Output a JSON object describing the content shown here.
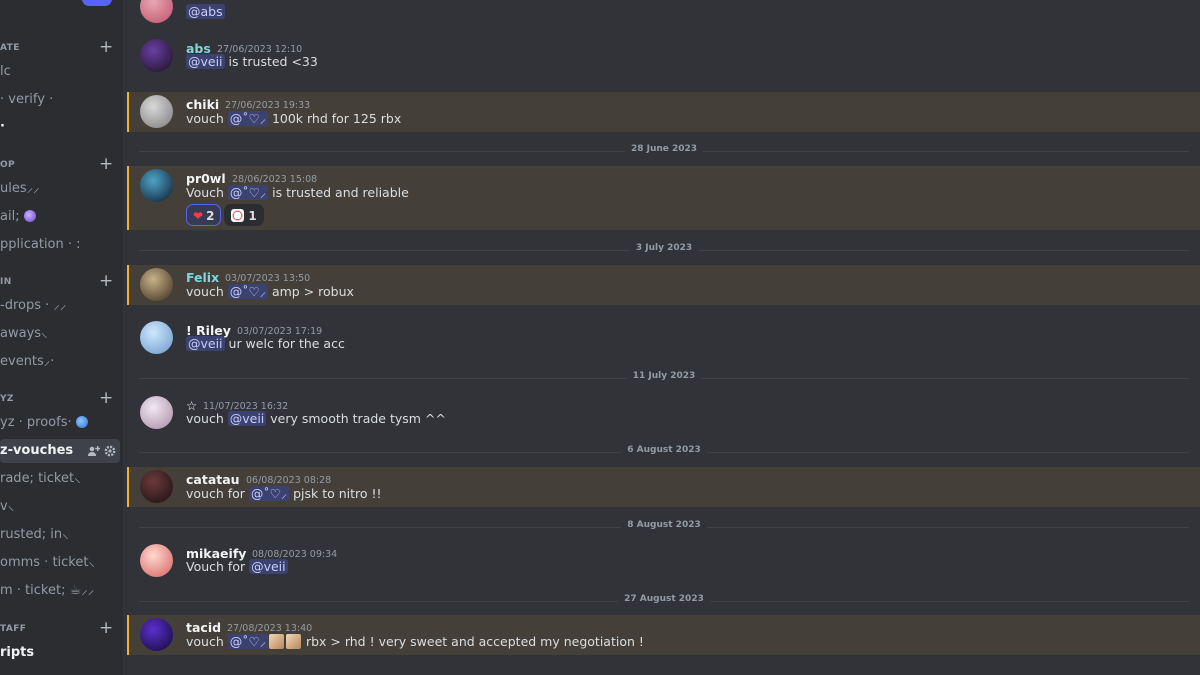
{
  "sidebar": {
    "categories": [
      {
        "label": "ATE",
        "channels": [
          {
            "label": "lc"
          },
          {
            "label": "· verify ·"
          },
          {
            "label": "·"
          }
        ]
      },
      {
        "label": "OP",
        "channels": [
          {
            "label": "ules⸝⸝"
          },
          {
            "label": "ail;"
          },
          {
            "label": "pplication · :"
          }
        ]
      },
      {
        "label": "IN",
        "channels": [
          {
            "label": "-drops · ⸝⸝"
          },
          {
            "label": "aways⸜"
          },
          {
            "label": " events⸝·"
          }
        ]
      },
      {
        "label": "YZ",
        "channels": [
          {
            "label": "yz · proofs·"
          },
          {
            "label": "z-vouches"
          },
          {
            "label": "rade; ticket⸜"
          },
          {
            "label": "v⸜"
          },
          {
            "label": "rusted; in⸜"
          },
          {
            "label": "omms · ticket⸜"
          },
          {
            "label": "m · ticket; ☕⸝⸝"
          }
        ]
      },
      {
        "label": "TAFF",
        "channels": [
          {
            "label": "ripts"
          }
        ]
      }
    ],
    "colors": {
      "selected_bg": "#404249",
      "muted": "#949ba4"
    }
  },
  "messages": [
    {
      "author": "",
      "timestamp": "",
      "content": [
        {
          "t": "mention",
          "v": "@abs"
        }
      ],
      "highlighted": false
    },
    {
      "author": "abs",
      "author_color": "#7ed6df",
      "timestamp": "27/06/2023 12:10",
      "content": [
        {
          "t": "mention",
          "v": "@veii"
        },
        {
          "t": "text",
          "v": " is trusted <33"
        }
      ],
      "highlighted": false
    },
    {
      "author": "chiki",
      "author_color": "#f2f3f5",
      "timestamp": "27/06/2023 19:33",
      "content": [
        {
          "t": "text",
          "v": "vouch "
        },
        {
          "t": "mention",
          "v": "@˚♡⸝"
        },
        {
          "t": "text",
          "v": "  100k rhd for 125 rbx"
        }
      ],
      "highlighted": true
    },
    {
      "author": "pr0wl",
      "author_color": "#f2f3f5",
      "timestamp": "28/06/2023 15:08",
      "content": [
        {
          "t": "text",
          "v": "Vouch "
        },
        {
          "t": "mention",
          "v": "@˚♡⸝"
        },
        {
          "t": "text",
          "v": " is trusted and reliable"
        }
      ],
      "highlighted": true,
      "reactions": [
        {
          "icon": "heart-icon",
          "count": "2",
          "me": true
        },
        {
          "icon": "cat-emoji-icon",
          "count": "1",
          "me": false
        }
      ]
    },
    {
      "author": "Felix",
      "author_color": "#7ed6df",
      "timestamp": "03/07/2023 13:50",
      "content": [
        {
          "t": "text",
          "v": "vouch "
        },
        {
          "t": "mention",
          "v": "@˚♡⸝"
        },
        {
          "t": "text",
          "v": " amp > robux"
        }
      ],
      "highlighted": true
    },
    {
      "author": "! Riley",
      "author_color": "#f2f3f5",
      "timestamp": "03/07/2023 17:19",
      "content": [
        {
          "t": "mention",
          "v": "@veii"
        },
        {
          "t": "text",
          "v": " ur welc for the acc"
        }
      ],
      "highlighted": false
    },
    {
      "author": "☆",
      "author_color": "#f2f3f5",
      "timestamp": "11/07/2023 16:32",
      "content": [
        {
          "t": "text",
          "v": "vouch "
        },
        {
          "t": "mention",
          "v": "@veii"
        },
        {
          "t": "text",
          "v": "  very smooth trade tysm ^^"
        }
      ],
      "highlighted": false
    },
    {
      "author": "catatau",
      "author_color": "#f2f3f5",
      "timestamp": "06/08/2023 08:28",
      "content": [
        {
          "t": "text",
          "v": "vouch for "
        },
        {
          "t": "mention",
          "v": "@˚♡⸝"
        },
        {
          "t": "text",
          "v": " pjsk to nitro !!"
        }
      ],
      "highlighted": true
    },
    {
      "author": "mikaeify",
      "author_color": "#f2f3f5",
      "timestamp": "08/08/2023 09:34",
      "content": [
        {
          "t": "text",
          "v": "Vouch for "
        },
        {
          "t": "mention",
          "v": "@veii"
        }
      ],
      "highlighted": false
    },
    {
      "author": "tacid",
      "author_color": "#f2f3f5",
      "timestamp": "27/08/2023 13:40",
      "content": [
        {
          "t": "text",
          "v": "vouch "
        },
        {
          "t": "mention",
          "v": "@˚♡⸝"
        },
        {
          "t": "emoji",
          "v": "dog-emoji-icon"
        },
        {
          "t": "emoji",
          "v": "dog-emoji-icon"
        },
        {
          "t": "text",
          "v": " rbx > rhd ! very sweet and accepted my negotiation !"
        }
      ],
      "highlighted": true
    }
  ],
  "dividers": [
    "28 June 2023",
    "3 July 2023",
    "11 July 2023",
    "6 August 2023",
    "8 August 2023",
    "27 August 2023"
  ],
  "colors": {
    "mention_bg": "#3c4270",
    "highlight_bg": "#444039",
    "highlight_border": "#f0b232",
    "bg": "#313338"
  }
}
